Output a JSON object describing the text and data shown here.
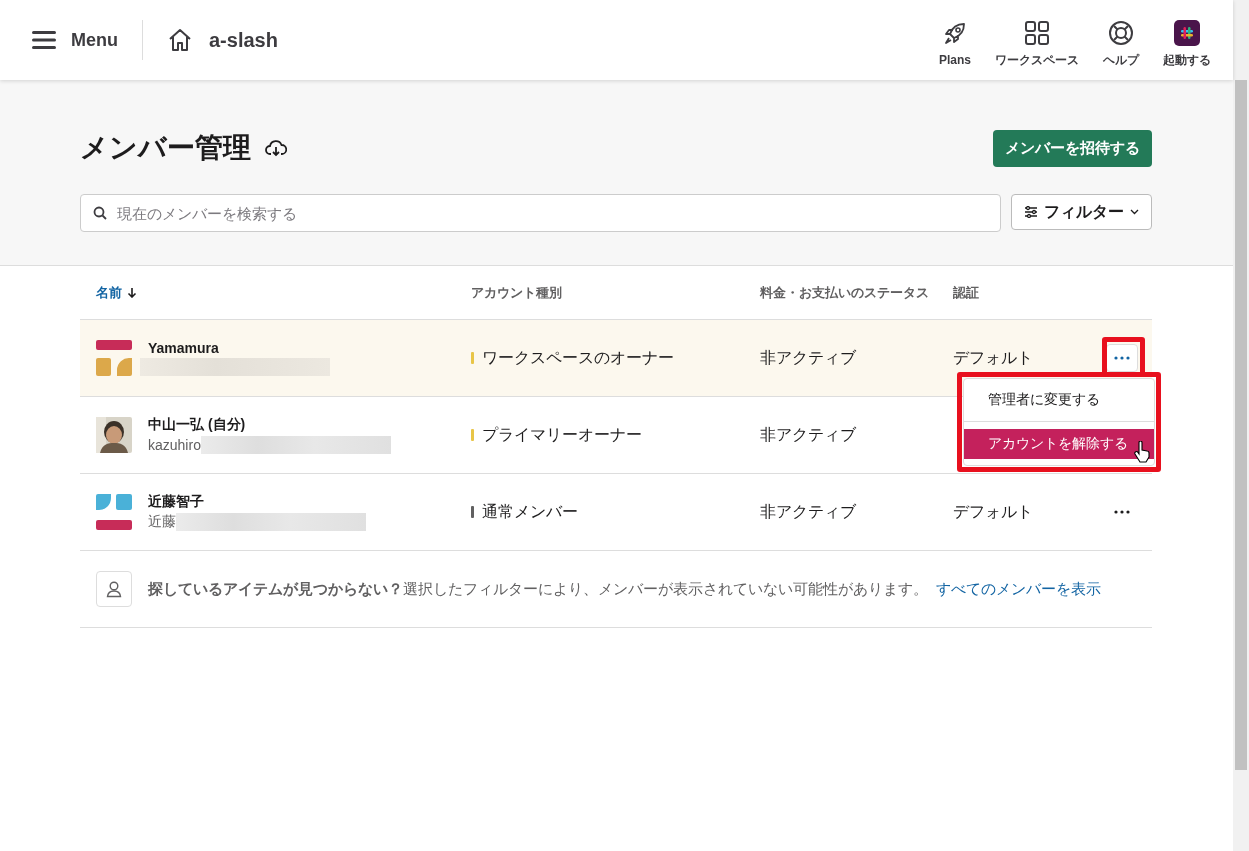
{
  "topbar": {
    "menu_label": "Menu",
    "workspace": "a-slash",
    "actions": [
      {
        "kind": "rocket",
        "label": "Plans"
      },
      {
        "kind": "grid",
        "label": "ワークスペース"
      },
      {
        "kind": "lifebuoy",
        "label": "ヘルプ"
      },
      {
        "kind": "app",
        "label": "起動する"
      }
    ]
  },
  "page": {
    "title": "メンバー管理",
    "invite_button": "メンバーを招待する",
    "search": {
      "placeholder": "現在のメンバーを検索する"
    },
    "filter_button": "フィルター"
  },
  "table": {
    "columns": [
      {
        "label": "名前",
        "sorted": true
      },
      {
        "label": "アカウント種別",
        "sorted": false
      },
      {
        "label": "料金・お支払いのステータス",
        "sorted": false
      },
      {
        "label": "認証",
        "sorted": false
      }
    ],
    "rows": [
      {
        "avatar": {
          "kind": "pattern-red-gold"
        },
        "name": "Yamamura",
        "email": "",
        "type": "ワークスペースのオーナー",
        "color": "#e8c547",
        "billing": "非アクティブ",
        "auth": "デフォルト",
        "selected": true,
        "menu_open": true
      },
      {
        "name": "中山一弘 (自分)",
        "email": "kazuhiro",
        "type": "プライマリーオーナー",
        "color": "#e8c547",
        "billing": "非アクティブ",
        "auth": "",
        "selected": false,
        "menu_open": false
      },
      {
        "avatar": {
          "kind": "pattern-blue-red"
        },
        "name": "近藤智子",
        "email": "近藤",
        "type": "通常メンバー",
        "color": "#616061",
        "billing": "非アクティブ",
        "auth": "デフォルト",
        "selected": false,
        "menu_open": false
      }
    ],
    "row_menu": [
      {
        "label": "管理者に変更する",
        "selected": false
      },
      {
        "label": "アカウントを解除する",
        "selected": true
      }
    ]
  },
  "notice": {
    "text": "**探しているアイテムが見つからない？**選択したフィルターにより、メンバーが表示されていない可能性があります。",
    "link": "すべてのメンバーを表示"
  }
}
